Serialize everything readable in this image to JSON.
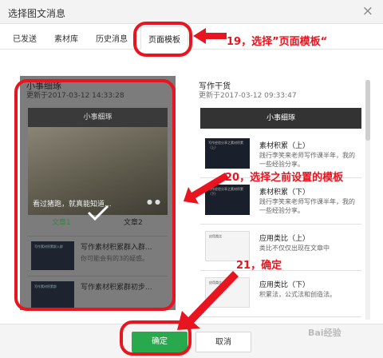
{
  "dialog": {
    "title": "选择图文消息",
    "close_glyph": "×"
  },
  "tabs": [
    {
      "label": "已发送"
    },
    {
      "label": "素材库"
    },
    {
      "label": "历史消息"
    },
    {
      "label": "页面模板"
    }
  ],
  "left": {
    "title": "小事细琢",
    "updated": "更新于2017-03-12 14:33:28",
    "header": "小事细琢",
    "caption": "看过猪跑，就真能知道...",
    "tab1": "文章1",
    "tab2": "文章2",
    "items": [
      {
        "title": "写作素材积累群入群...",
        "sub": "你可能会有的3的疑惑。",
        "thumb": "写作素材积累群入群"
      },
      {
        "title": "写作素材积累群初步...",
        "sub": "",
        "thumb": "写作素材积累群"
      }
    ]
  },
  "right": {
    "title": "写作干货",
    "updated": "更新于2017-03-12 09:33:47",
    "header": "小事细琢",
    "items": [
      {
        "title": "素材积累（上）",
        "sub": "践行李笑来老师写作课半年，我的一些经验分享。",
        "thumb": "写作经验分享之素材积累（上）"
      },
      {
        "title": "素材积累（下）",
        "sub": "践行李笑来老师写作课半年，我的一些经验分享。",
        "thumb": "写作经验分享之素材积累（下）"
      },
      {
        "title": "应用类比（上）",
        "sub": "类比不仅仅出现在文章中",
        "thumb": "应用类比"
      },
      {
        "title": "应用类比（下）",
        "sub": "积累法，公式法和创造法。",
        "thumb": "应用类比"
      }
    ]
  },
  "annotations": {
    "a19": "19，选择”页面模板“",
    "a20": "20，选择之前设置的模板",
    "a21": "21，确定"
  },
  "footer": {
    "ok": "确定",
    "cancel": "取消",
    "watermark": "Bai经验"
  }
}
